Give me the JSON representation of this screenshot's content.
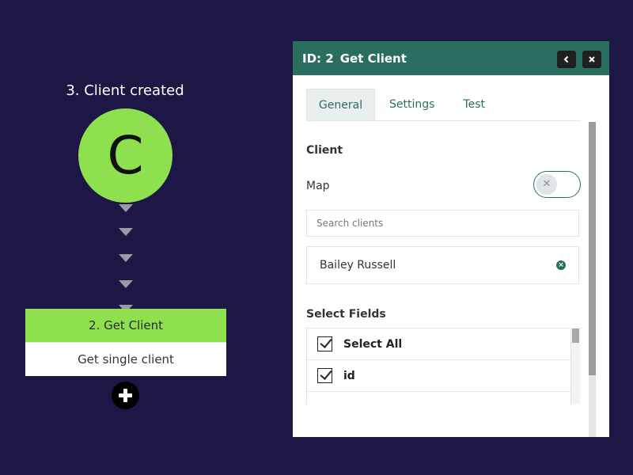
{
  "flow": {
    "trigger_title": "3. Client created",
    "trigger_letter": "C",
    "step_title": "2. Get Client",
    "step_subtitle": "Get single client"
  },
  "panel": {
    "id_label": "ID: 2",
    "title": "Get Client",
    "tabs": [
      {
        "label": "General",
        "active": true
      },
      {
        "label": "Settings",
        "active": false
      },
      {
        "label": "Test",
        "active": false
      }
    ],
    "client_section": "Client",
    "map_label": "Map",
    "map_enabled": false,
    "search_placeholder": "Search clients",
    "selected_client": "Bailey Russell",
    "fields_section": "Select Fields",
    "fields": [
      {
        "label": "Select All",
        "checked": true
      },
      {
        "label": "id",
        "checked": true
      }
    ]
  },
  "colors": {
    "background": "#1c1745",
    "node_green": "#8ee04f",
    "panel_header": "#2a6e60"
  },
  "icons": {
    "back": "chevron-left-icon",
    "close": "close-icon",
    "add": "plus-icon",
    "remove": "remove-circle-icon",
    "toggle_off": "x-icon"
  }
}
